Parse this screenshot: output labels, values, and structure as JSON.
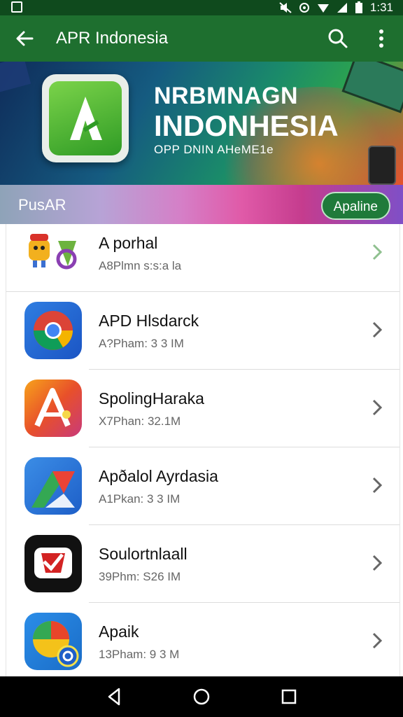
{
  "status_bar": {
    "time": "1:31"
  },
  "app_bar": {
    "title": "APR Indonesia"
  },
  "banner": {
    "line1": "NRBMNAGN",
    "line2": "INDONHESIA",
    "line3": "OPP DNIN AHeME1e"
  },
  "section": {
    "label": "PusAR",
    "action_label": "Apaline"
  },
  "apps": [
    {
      "name": "A porhal",
      "meta": "A8Plmn s:s:a la",
      "icon": "mascot-icon"
    },
    {
      "name": "APD Hlsdarck",
      "meta": "A?Pham: 3 3 IM",
      "icon": "chrome-like-icon"
    },
    {
      "name": "SpolingHaraka",
      "meta": "X7Phan: 32.1M",
      "icon": "red-orange-a-icon"
    },
    {
      "name": "Apðalol Ayrdasia",
      "meta": "A1Pkan: 3 3 IM",
      "icon": "blue-green-red-icon"
    },
    {
      "name": "Soulortnlaall",
      "meta": "39Phm: S26 IM",
      "icon": "red-check-icon"
    },
    {
      "name": "Apaik",
      "meta": "13Pham: 9 3 M",
      "icon": "colorful-clock-icon"
    }
  ],
  "colors": {
    "app_bar": "#1e6f2f",
    "status_bar": "#0f4a1d",
    "section_button": "#1f7a3a"
  }
}
